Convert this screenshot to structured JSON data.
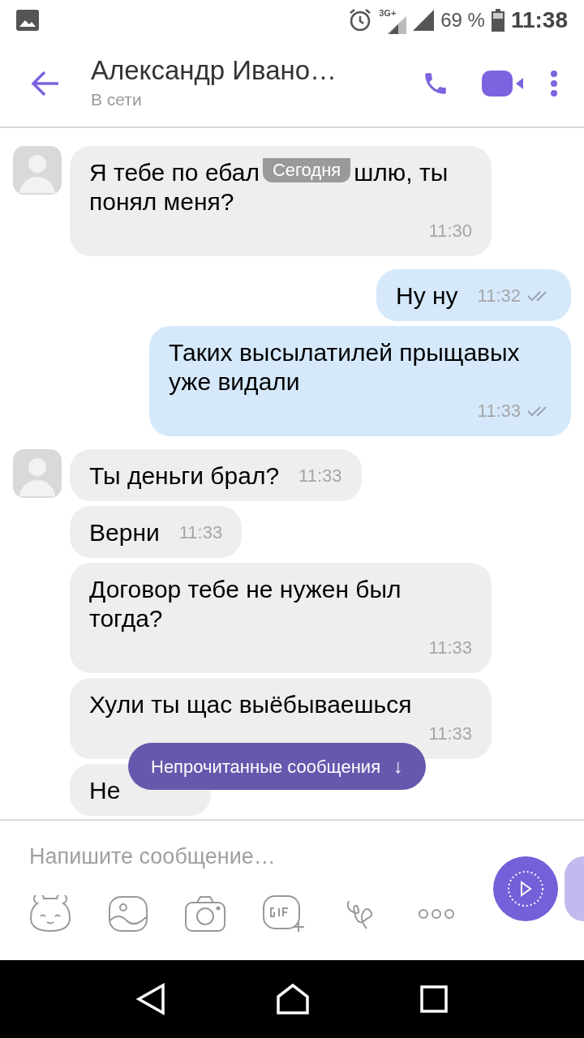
{
  "status_bar": {
    "network": "3G+",
    "battery": "69 %",
    "time": "11:38"
  },
  "header": {
    "title": "Александр Ивано…",
    "subtitle": "В сети"
  },
  "messages": [
    {
      "kind": "incoming",
      "avatar": true,
      "parts": [
        "Я тебе по ебал",
        "шлю, ты понял меня?"
      ],
      "overlay_label": "Сегодня",
      "time": "11:30"
    },
    {
      "kind": "outgoing",
      "parts": [
        "Ну ну"
      ],
      "time": "11:32",
      "delivered": true
    },
    {
      "kind": "outgoing",
      "parts": [
        "Таких высылатилей прыщавых уже видали"
      ],
      "time": "11:33",
      "delivered": true
    },
    {
      "kind": "incoming",
      "avatar": true,
      "parts": [
        "Ты деньги брал?"
      ],
      "time": "11:33"
    },
    {
      "kind": "incoming",
      "avatar": false,
      "parts": [
        "Верни"
      ],
      "time": "11:33"
    },
    {
      "kind": "incoming",
      "avatar": false,
      "parts": [
        "Договор тебе не нужен был тогда?"
      ],
      "time": "11:33"
    },
    {
      "kind": "incoming",
      "avatar": false,
      "parts": [
        "Хули ты щас выёбываешься"
      ],
      "time": "11:33"
    },
    {
      "kind": "incoming",
      "avatar": false,
      "parts": [
        "Не"
      ]
    }
  ],
  "unread_button": {
    "label": "Непрочитанные сообщения",
    "arrow": "↓"
  },
  "composer": {
    "placeholder": "Напишите сообщение…"
  }
}
